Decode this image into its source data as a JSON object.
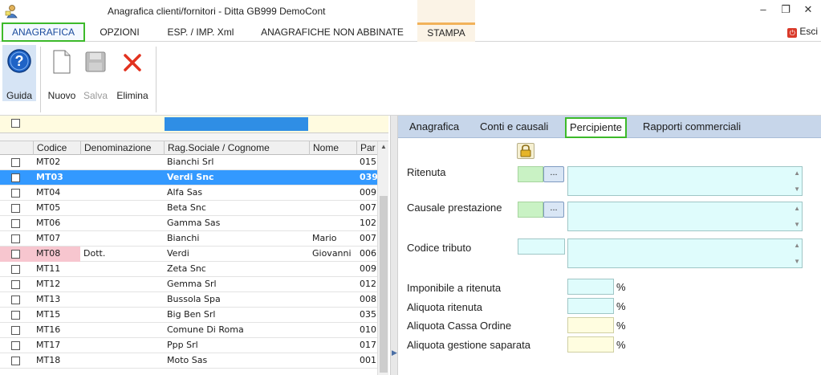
{
  "window": {
    "title": "Anagrafica clienti/fornitori - Ditta GB999 DemoCont",
    "minimize": "–",
    "restore": "❐",
    "close": "✕"
  },
  "menu": {
    "items": [
      "ANAGRAFICA",
      "OPZIONI",
      "ESP. / IMP. Xml",
      "ANAGRAFICHE NON ABBINATE",
      "STAMPA"
    ],
    "exit_label": "Esci"
  },
  "ribbon": {
    "guida": "Guida",
    "nuovo": "Nuovo",
    "salva": "Salva",
    "elimina": "Elimina"
  },
  "grid": {
    "columns": [
      "Codice",
      "Denominazione",
      "Rag.Sociale / Cognome",
      "Nome",
      "Par"
    ],
    "rows": [
      {
        "code": "MT02",
        "denom": "",
        "rag": "Bianchi Srl",
        "nome": "",
        "par": "015"
      },
      {
        "code": "MT03",
        "denom": "",
        "rag": "Verdi Snc",
        "nome": "",
        "par": "039"
      },
      {
        "code": "MT04",
        "denom": "",
        "rag": "Alfa Sas",
        "nome": "",
        "par": "009"
      },
      {
        "code": "MT05",
        "denom": "",
        "rag": "Beta Snc",
        "nome": "",
        "par": "007"
      },
      {
        "code": "MT06",
        "denom": "",
        "rag": "Gamma Sas",
        "nome": "",
        "par": "102"
      },
      {
        "code": "MT07",
        "denom": "",
        "rag": "Bianchi",
        "nome": "Mario",
        "par": "007"
      },
      {
        "code": "MT08",
        "denom": "Dott.",
        "rag": "Verdi",
        "nome": "Giovanni",
        "par": "006"
      },
      {
        "code": "MT11",
        "denom": "",
        "rag": "Zeta Snc",
        "nome": "",
        "par": "009"
      },
      {
        "code": "MT12",
        "denom": "",
        "rag": "Gemma Srl",
        "nome": "",
        "par": "012"
      },
      {
        "code": "MT13",
        "denom": "",
        "rag": "Bussola Spa",
        "nome": "",
        "par": "008"
      },
      {
        "code": "MT15",
        "denom": "",
        "rag": "Big Ben Srl",
        "nome": "",
        "par": "035"
      },
      {
        "code": "MT16",
        "denom": "",
        "rag": "Comune Di Roma",
        "nome": "",
        "par": "010"
      },
      {
        "code": "MT17",
        "denom": "",
        "rag": "Ppp Srl",
        "nome": "",
        "par": "017"
      },
      {
        "code": "MT18",
        "denom": "",
        "rag": "Moto Sas",
        "nome": "",
        "par": "001"
      }
    ]
  },
  "tabs": [
    "Anagrafica",
    "Conti e causali",
    "Percipiente",
    "Rapporti commerciali"
  ],
  "form": {
    "ritenuta": "Ritenuta",
    "causale": "Causale prestazione",
    "codice_tributo": "Codice tributo",
    "imponibile": "Imponibile a ritenuta",
    "aliquota_ritenuta": "Aliquota ritenuta",
    "aliquota_cassa": "Aliquota Cassa Ordine",
    "aliquota_gestione": "Aliquota gestione saparata",
    "dots": "...",
    "pct": "%"
  }
}
